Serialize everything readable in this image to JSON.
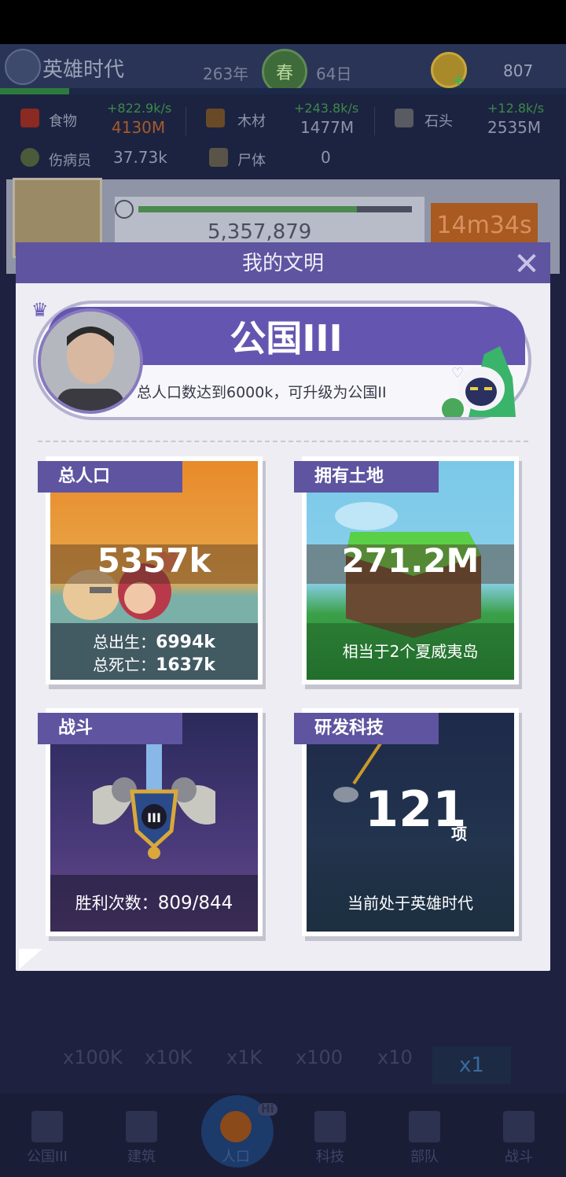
{
  "header": {
    "era": "英雄时代",
    "year": "263年",
    "season": "春",
    "day": "64日",
    "gold": "807"
  },
  "resources": {
    "food": {
      "label": "食物",
      "rate": "+822.9k/s",
      "value": "4130M"
    },
    "wood": {
      "label": "木材",
      "rate": "+243.8k/s",
      "value": "1477M"
    },
    "stone": {
      "label": "石头",
      "rate": "+12.8k/s",
      "value": "2535M"
    },
    "wounded": {
      "label": "伤病员",
      "value": "37.73k"
    },
    "corpses": {
      "label": "尸体",
      "value": "0"
    }
  },
  "behind": {
    "population": "5,357,879",
    "timer": "14m34s"
  },
  "dialog": {
    "title": "我的文明",
    "rank": "公国III",
    "rank_desc": "总人口数达到6000k，可升级为公国II",
    "cards": {
      "population": {
        "tag": "总人口",
        "value": "5357k",
        "births_label": "总出生：",
        "births": "6994k",
        "deaths_label": "总死亡：",
        "deaths": "1637k"
      },
      "land": {
        "tag": "拥有土地",
        "value": "271.2M",
        "note": "相当于2个夏威夷岛"
      },
      "battle": {
        "tag": "战斗",
        "emblem": "III",
        "wins_label": "胜利次数：",
        "wins": "809/844"
      },
      "tech": {
        "tag": "研发科技",
        "value": "121",
        "unit": "项",
        "note": "当前处于英雄时代"
      }
    }
  },
  "multipliers": [
    "x100K",
    "x10K",
    "x1K",
    "x100",
    "x10",
    "x1"
  ],
  "tabs": [
    {
      "label": "公国III"
    },
    {
      "label": "建筑"
    },
    {
      "label": "人口"
    },
    {
      "label": "科技"
    },
    {
      "label": "部队"
    },
    {
      "label": "战斗"
    }
  ],
  "tab_badge": "Hi",
  "colors": {
    "accent": "#5e54a0",
    "dialog_bg": "#ededf3",
    "tab_active": "#1c3a6a"
  }
}
